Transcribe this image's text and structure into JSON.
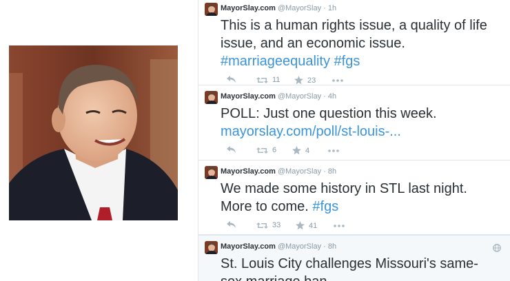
{
  "tweets": [
    {
      "name": "MayorSlay.com",
      "handle": "@MayorSlay",
      "dot": "·",
      "time": "1h",
      "line1": "This is a human rights issue, a quality of life",
      "line2": "issue, and an economic issue.",
      "line3": "#marriageequality #fgs",
      "retweets": "11",
      "favorites": "23"
    },
    {
      "name": "MayorSlay.com",
      "handle": "@MayorSlay",
      "dot": "·",
      "time": "4h",
      "line1": "POLL: Just one question this week.",
      "line2": "mayorslay.com/poll/st-louis-...",
      "retweets": "6",
      "favorites": "4"
    },
    {
      "name": "MayorSlay.com",
      "handle": "@MayorSlay",
      "dot": "·",
      "time": "8h",
      "line1": "We made some history in STL last night.",
      "line2a": "More to come.",
      "line2b": "#fgs",
      "retweets": "33",
      "favorites": "41"
    },
    {
      "name": "MayorSlay.com",
      "handle": "@MayorSlay",
      "dot": "·",
      "time": "8h",
      "line1": "St. Louis City challenges Missouri's same-",
      "line2": "sex marriage ban"
    }
  ],
  "colors": {
    "text": "#292f33",
    "muted": "#8899a6",
    "link": "#3b94d9",
    "divider": "#e1e8ed"
  },
  "icons": [
    "reply-icon",
    "retweet-icon",
    "favorite-icon",
    "more-icon",
    "globe-icon"
  ]
}
